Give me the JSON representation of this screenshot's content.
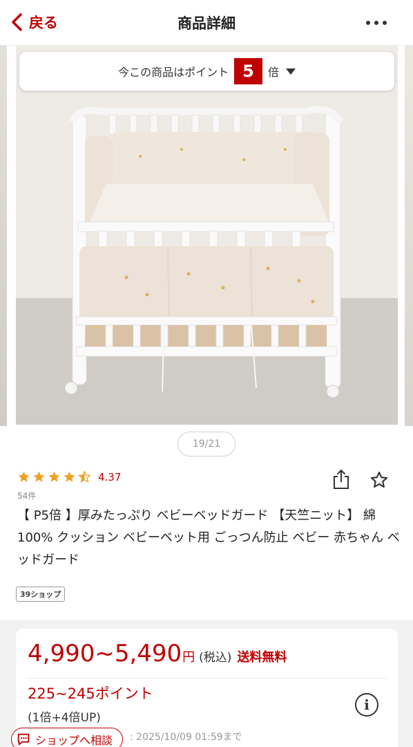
{
  "header": {
    "back_label": "戻る",
    "title": "商品詳細"
  },
  "points_banner": {
    "prefix": "今この商品はポイント",
    "multiplier": "5",
    "suffix": "倍"
  },
  "gallery": {
    "counter": "19/21"
  },
  "product": {
    "rating": 4.37,
    "rating_text": "4.37",
    "review_count": "54件",
    "name": "【 P5倍 】厚みたっぷり ベビーベッドガード 【天竺ニット】 綿100% クッション ベビーベット用 ごっつん防止 ベビー 赤ちゃん ベッドガード",
    "shop_badge": "39ショップ"
  },
  "price": {
    "range": "4,990~5,490",
    "yen": "円",
    "tax": "(税込)",
    "shipping": "送料無料",
    "points": "225~245ポイント",
    "points_detail": "(1倍+4倍UP)",
    "deadline": ": 2025/10/09 01:59まで"
  },
  "consult_button": {
    "label": "ショップへ相談"
  },
  "colors": {
    "accent": "#bf0000",
    "star": "#f0a020"
  }
}
